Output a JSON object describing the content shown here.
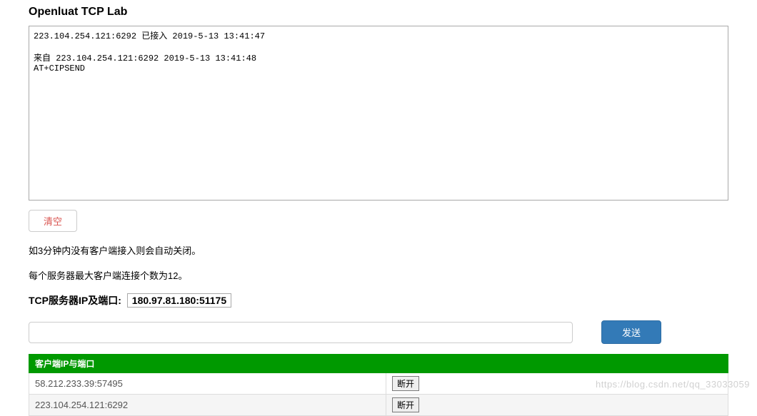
{
  "header": {
    "title": "Openluat TCP Lab"
  },
  "log": {
    "content": "223.104.254.121:6292 已接入 2019-5-13 13:41:47\n\n来自 223.104.254.121:6292 2019-5-13 13:41:48\nAT+CIPSEND"
  },
  "actions": {
    "clear_label": "清空",
    "send_label": "发送",
    "disconnect_label": "断开"
  },
  "info": {
    "line1": "如3分钟内没有客户端接入则会自动关闭。",
    "line2": "每个服务器最大客户端连接个数为12。"
  },
  "server": {
    "label": "TCP服务器IP及端口:",
    "address": "180.97.81.180:51175"
  },
  "send": {
    "value": "",
    "placeholder": ""
  },
  "clients": {
    "header_ip": "客户端IP与端口",
    "header_action": "",
    "rows": [
      {
        "ip": "58.212.233.39:57495"
      },
      {
        "ip": "223.104.254.121:6292"
      }
    ]
  },
  "watermark": "https://blog.csdn.net/qq_33033059"
}
